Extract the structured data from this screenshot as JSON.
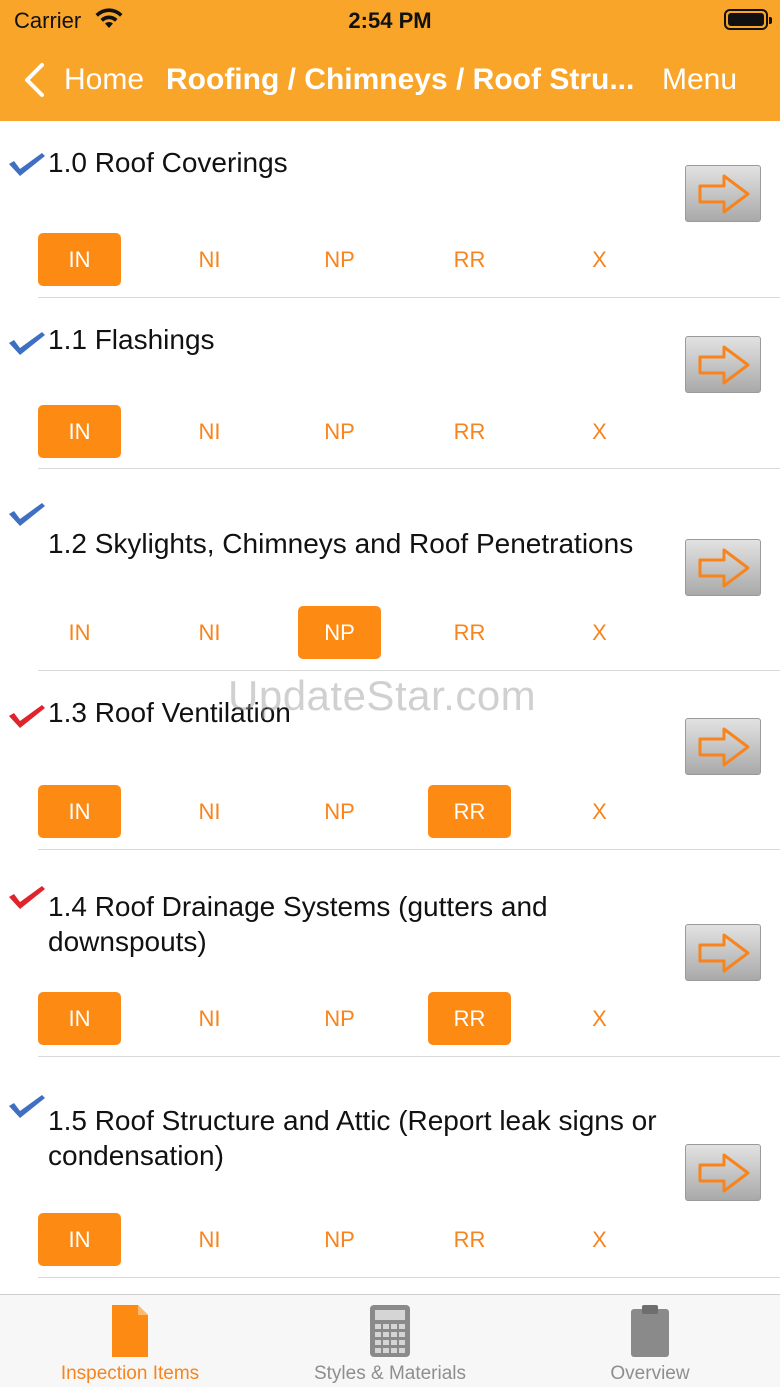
{
  "status_bar": {
    "carrier": "Carrier",
    "time": "2:54 PM"
  },
  "nav": {
    "back_label": "Home",
    "title": "Roofing / Chimneys / Roof Stru...",
    "menu_label": "Menu"
  },
  "rating_labels": [
    "IN",
    "NI",
    "NP",
    "RR",
    "X"
  ],
  "items": [
    {
      "title": "1.0 Roof Coverings",
      "check_color": "#3f6fc3",
      "selected": [
        "IN"
      ]
    },
    {
      "title": "1.1 Flashings",
      "check_color": "#3f6fc3",
      "selected": [
        "IN"
      ]
    },
    {
      "title": "1.2 Skylights, Chimneys and Roof Penetrations",
      "check_color": "#3f6fc3",
      "selected": [
        "NP"
      ]
    },
    {
      "title": "1.3 Roof Ventilation",
      "check_color": "#e0242c",
      "selected": [
        "IN",
        "RR"
      ]
    },
    {
      "title": "1.4 Roof Drainage Systems (gutters and downspouts)",
      "check_color": "#e0242c",
      "selected": [
        "IN",
        "RR"
      ]
    },
    {
      "title": "1.5 Roof Structure and Attic (Report leak signs or condensation)",
      "check_color": "#3f6fc3",
      "selected": [
        "IN"
      ]
    }
  ],
  "watermark": "UpdateStar.com",
  "tabs": [
    {
      "label": "Inspection Items",
      "icon": "document-icon",
      "active": true
    },
    {
      "label": "Styles & Materials",
      "icon": "calculator-icon",
      "active": false
    },
    {
      "label": "Overview",
      "icon": "clipboard-icon",
      "active": false
    }
  ],
  "colors": {
    "header": "#f9a52a",
    "accent": "#fd8a12",
    "check_blue": "#3f6fc3",
    "check_red": "#e0242c"
  }
}
